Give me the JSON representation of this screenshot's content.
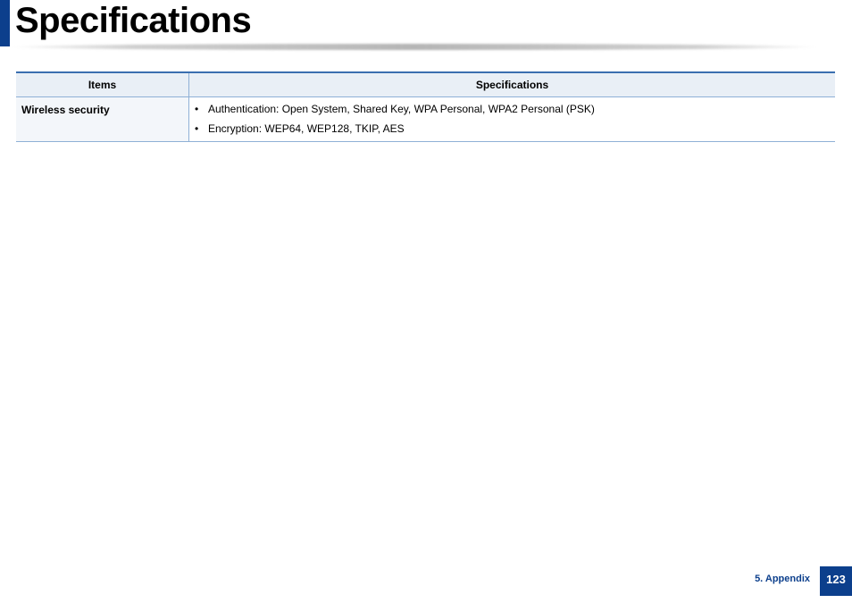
{
  "header": {
    "title": "Specifications"
  },
  "table": {
    "columns": [
      "Items",
      "Specifications"
    ],
    "rows": [
      {
        "item": "Wireless security",
        "specs": [
          "Authentication: Open System, Shared Key, WPA Personal, WPA2 Personal (PSK)",
          "Encryption: WEP64, WEP128, TKIP, AES"
        ]
      }
    ]
  },
  "footer": {
    "section": "5.  Appendix",
    "page_number": "123"
  },
  "colors": {
    "accent": "#0c3f8c",
    "table_header_bg": "#e9eff6",
    "table_border": "#8fb0d6"
  },
  "icons": {
    "bullet": "•"
  }
}
